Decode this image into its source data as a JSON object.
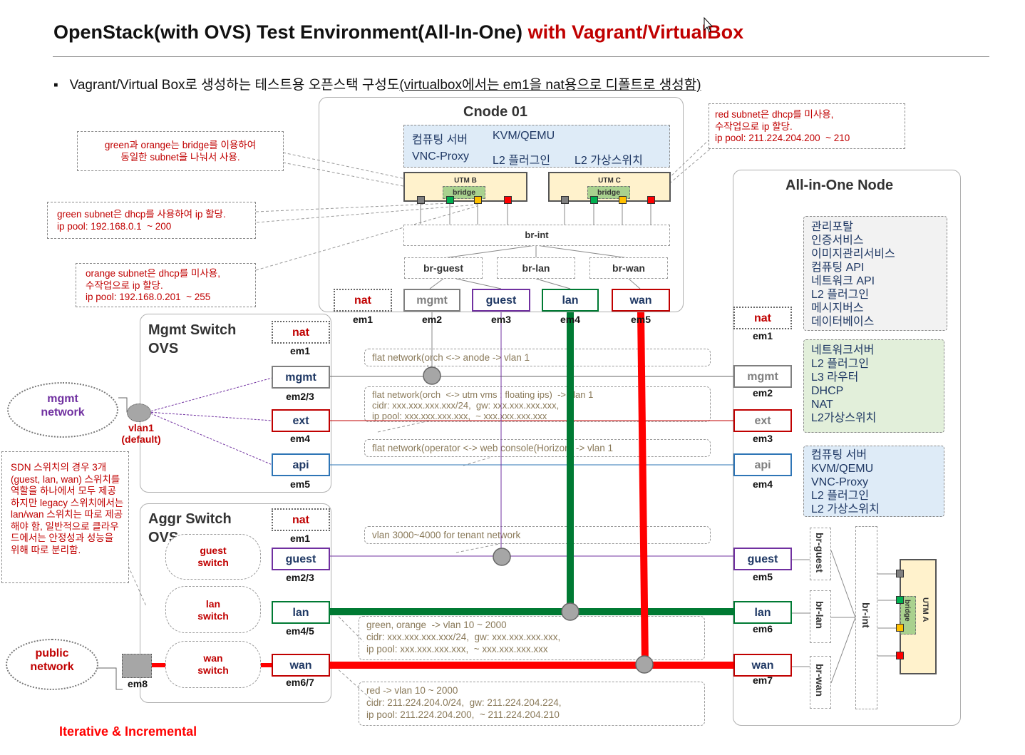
{
  "title": {
    "main": "OpenStack(with OVS) Test Environment(All-In-One) ",
    "highlight": "with Vagrant/VirtualBox"
  },
  "subtitle": {
    "bullet": "▪",
    "plain": "Vagrant/Virtual Box로 생성하는 테스트용 오픈스택 구성도",
    "underlined": "(virtualbox에서는 em1을 nat용으로 디폴트로 생성함)"
  },
  "colors": {
    "red": "#ff0000",
    "green": "#007a33",
    "title_red": "#c00000",
    "purple": "#7030a0",
    "blue": "#2e75b6"
  },
  "cnode": {
    "title": "Cnode 01",
    "services": {
      "r1c1": "컴퓨팅 서버",
      "r1c2": "KVM/QEMU",
      "r2c1": "VNC-Proxy",
      "r2c2": "L2 플러그인",
      "r2c3": "L2 가상스위치"
    },
    "utm_b": "UTM B",
    "utm_c": "UTM C",
    "bridge": "bridge",
    "br_int": "br-int",
    "br_guest": "br-guest",
    "br_lan": "br-lan",
    "br_wan": "br-wan",
    "ports": [
      {
        "name": "nat",
        "nic": "em1"
      },
      {
        "name": "mgmt",
        "nic": "em2"
      },
      {
        "name": "guest",
        "nic": "em3"
      },
      {
        "name": "lan",
        "nic": "em4"
      },
      {
        "name": "wan",
        "nic": "em5"
      }
    ]
  },
  "notes": {
    "green_orange_bridge": "green과 orange는 bridge를 이용하여\n동일한 subnet을 나눠서 사용.",
    "green_subnet": "green subnet은 dhcp를 사용하여 ip 할당.\nip pool: 192.168.0.1  ~ 200",
    "orange_subnet": "orange subnet은 dhcp를 미사용,\n수작업으로 ip 할당.\nip pool: 192.168.0.201  ~ 255",
    "red_subnet": "red subnet은 dhcp를 미사용,\n수작업으로 ip 할당.\nip pool: 211.224.204.200  ~ 210",
    "sdn": "SDN 스위치의 경우 3개 (guest, lan, wan) 스위치를 역할을 하나에서 모두 제공하지만 legacy 스위치에서는 lan/wan 스위치는 따로 제공 해야 함, 일반적으로 클라우드에서는 안정성과 성능을 위해 따로 분리함."
  },
  "mgmt_switch": {
    "title": "Mgmt Switch\nOVS",
    "ports": [
      {
        "name": "nat",
        "nic": "em1"
      },
      {
        "name": "mgmt",
        "nic": "em2/3"
      },
      {
        "name": "ext",
        "nic": "em4"
      },
      {
        "name": "api",
        "nic": "em5"
      }
    ]
  },
  "aggr_switch": {
    "title": "Aggr Switch\nOVS",
    "ports": [
      {
        "name": "nat",
        "nic": "em1"
      },
      {
        "name": "guest",
        "nic": "em2/3"
      },
      {
        "name": "lan",
        "nic": "em4/5"
      },
      {
        "name": "wan",
        "nic": "em6/7"
      }
    ],
    "pills": [
      "guest\nswitch",
      "lan\nswitch",
      "wan\nswitch"
    ]
  },
  "clouds": {
    "mgmt": "mgmt\nnetwork",
    "public": "public\nnetwork"
  },
  "vlan_label": "vlan1\n(default)",
  "em8_label": "em8",
  "network_notes": {
    "flat1": "flat network(orch  <-> anode  -> vlan 1",
    "flat2": "flat network(orch  <-> utm vms : floating ips)  -> vlan 1\ncidr: xxx.xxx.xxx.xxx/24,  gw: xxx.xxx.xxx.xxx,\nip pool: xxx.xxx.xxx.xxx,  ~ xxx.xxx.xxx.xxx",
    "flat3": "flat network(operator  <-> web console(Horizon)  -> vlan 1",
    "vlan_tenant": "vlan 3000~4000 for tenant network",
    "green_orange": "green, orange  -> vlan 10 ~ 2000\ncidr: xxx.xxx.xxx.xxx/24,  gw: xxx.xxx.xxx.xxx,\nip pool: xxx.xxx.xxx.xxx,  ~ xxx.xxx.xxx.xxx",
    "red": "red -> vlan 10 ~ 2000\ncidr: 211.224.204.0/24,  gw: 211.224.204.224,\nip pool: 211.224.204.200,  ~ 211.224.204.210"
  },
  "aio": {
    "title": "All-in-One  Node",
    "svc_gray": [
      "관리포탈",
      "인증서비스",
      "이미지관리서비스",
      "컴퓨팅 API",
      "네트워크 API",
      "L2 플러그인",
      "메시지버스",
      "데이터베이스"
    ],
    "svc_green": [
      "네트워크서버",
      "L2 플러그인",
      "L3 라우터",
      "DHCP",
      "NAT",
      "L2가상스위치"
    ],
    "svc_blue": [
      "컴퓨팅 서버",
      "KVM/QEMU",
      "VNC-Proxy",
      "L2 플러그인",
      "L2 가상스위치"
    ],
    "ports": [
      {
        "name": "nat",
        "nic": "em1"
      },
      {
        "name": "mgmt",
        "nic": "em2"
      },
      {
        "name": "ext",
        "nic": "em3"
      },
      {
        "name": "api",
        "nic": "em4"
      },
      {
        "name": "guest",
        "nic": "em5"
      },
      {
        "name": "lan",
        "nic": "em6"
      },
      {
        "name": "wan",
        "nic": "em7"
      }
    ],
    "br_guest": "br-guest",
    "br_lan": "br-lan",
    "br_wan": "br-wan",
    "br_int": "br-int",
    "utm_a": "UTM A",
    "bridge": "bridge"
  },
  "footer": "Iterative & Incremental"
}
